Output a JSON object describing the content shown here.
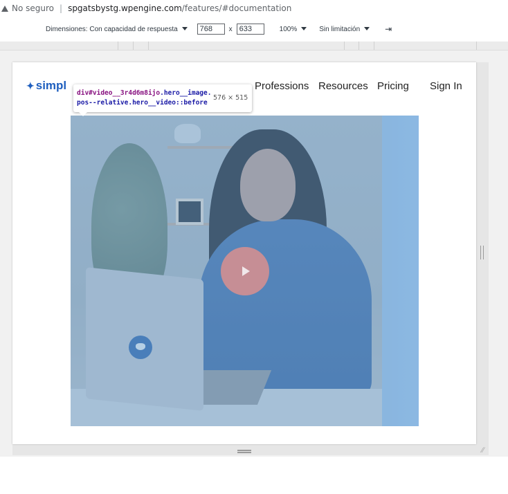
{
  "address_bar": {
    "security_label": "No seguro",
    "host": "spgatsbystg.wpengine.com",
    "path": "/features/#documentation"
  },
  "device_toolbar": {
    "dimensions_label": "Dimensiones: Con capacidad de respuesta",
    "width": "768",
    "times": "x",
    "height": "633",
    "zoom": "100%",
    "throttling": "Sin limitación"
  },
  "site_nav": {
    "logo_text": "simpl",
    "links": [
      "Professions",
      "Resources",
      "Pricing",
      "Sign In"
    ]
  },
  "inspector_tooltip": {
    "selector_tag": "div#video__3r4d6m8ijo",
    "selector_classes": ".hero__image.pos--relative.hero__video::before",
    "size": "576 × 515"
  },
  "colors": {
    "overlay": "#6fa8dc",
    "play_button": "#c68e95",
    "logo": "#1f5fbf"
  }
}
